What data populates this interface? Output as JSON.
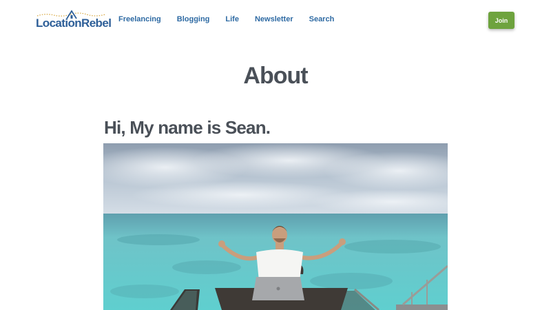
{
  "header": {
    "logo_text": "LocationRebel",
    "nav": [
      {
        "label": "Freelancing"
      },
      {
        "label": "Blogging"
      },
      {
        "label": "Life"
      },
      {
        "label": "Newsletter"
      },
      {
        "label": "Search"
      }
    ],
    "join_label": "Join"
  },
  "main": {
    "title": "About",
    "intro_heading": "Hi, My name is Sean."
  },
  "colors": {
    "brand_blue": "#2e5f98",
    "nav_blue": "#2e6aa3",
    "join_green": "#6ea33e",
    "heading_gray": "#4a5058",
    "logo_dots": "#d6a43a"
  },
  "icons": {
    "logo_mark": "house-roof-icon"
  }
}
